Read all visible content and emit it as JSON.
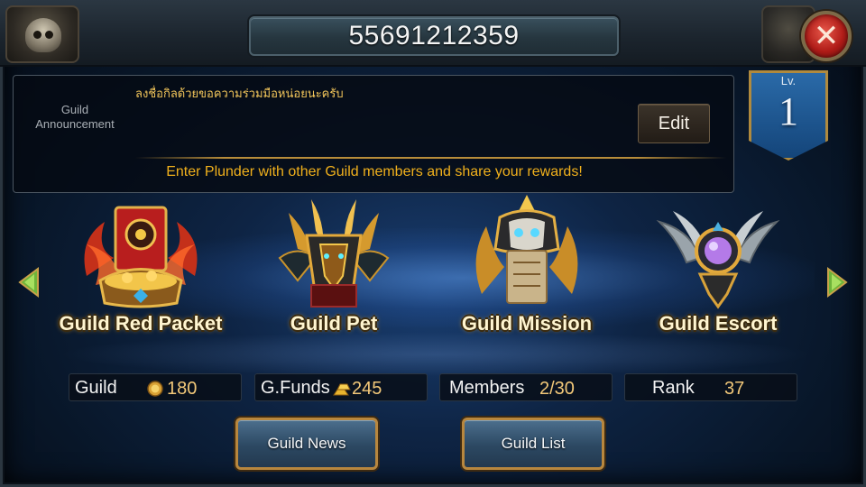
{
  "header": {
    "title": "55691212359",
    "close_icon": "close-x-icon"
  },
  "announcement": {
    "label": "Guild Announcement",
    "text": "ลงชื่อกิลด้วยขอความร่วมมือหน่อยนะครับ",
    "edit_label": "Edit",
    "hint": "Enter Plunder with other Guild members and share your rewards!"
  },
  "level": {
    "prefix": "Lv.",
    "value": "1"
  },
  "features": [
    {
      "label": "Guild Red Packet",
      "icon": "red-packet-emblem-icon"
    },
    {
      "label": "Guild Pet",
      "icon": "dragon-emblem-icon"
    },
    {
      "label": "Guild Mission",
      "icon": "mission-scroll-emblem-icon"
    },
    {
      "label": "Guild Escort",
      "icon": "escort-orb-emblem-icon"
    }
  ],
  "stats": {
    "guild": {
      "label": "Guild",
      "value": "180",
      "icon": "gold-coin-icon"
    },
    "funds": {
      "label": "G.Funds",
      "value": "245",
      "icon": "gold-bars-icon"
    },
    "members": {
      "label": "Members",
      "value": "2/30"
    },
    "rank": {
      "label": "Rank",
      "value": "37"
    }
  },
  "buttons": {
    "news": "Guild News",
    "list": "Guild List"
  },
  "colors": {
    "gold_text": "#f0b01c",
    "accent_blue": "#1f5d9b",
    "close_red": "#c4221c"
  }
}
